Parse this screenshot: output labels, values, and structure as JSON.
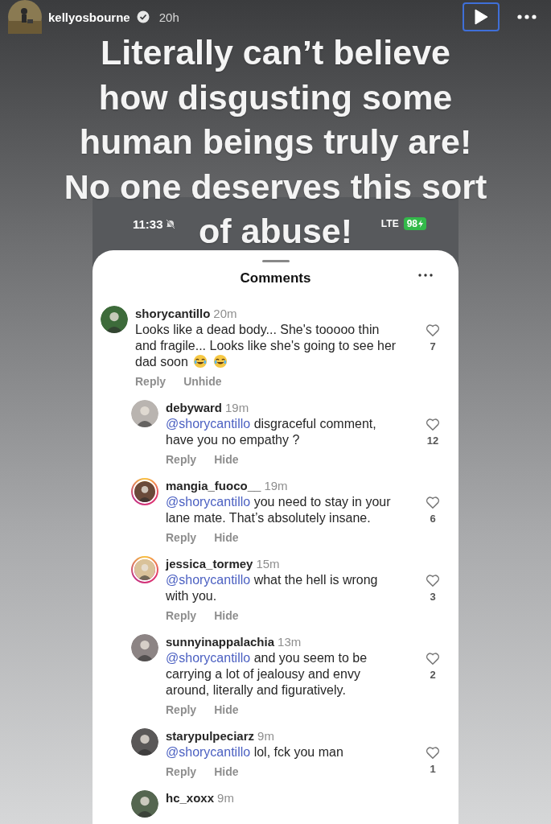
{
  "story": {
    "username": "kellyosbourne",
    "verified": true,
    "time": "20h"
  },
  "caption_lines": [
    "Literally can’t believe",
    "how disgusting some",
    "human beings truly are!",
    "No one deserves this sort",
    "of abuse!"
  ],
  "screenshot": {
    "status_bar": {
      "time": "11:33",
      "muted": true,
      "network": "LTE",
      "battery": "98"
    },
    "sheet_title": "Comments",
    "comments": [
      {
        "user": "shorycantillo",
        "time": "20m",
        "text": "Looks like a dead body... She's tooooo thin and fragile... Looks like she's going to see her dad soon",
        "ends_with_emojis": true,
        "likes": "7",
        "story_ring": false,
        "actions": [
          "Reply",
          "Unhide"
        ],
        "children": [
          {
            "user": "debyward",
            "time": "19m",
            "mention": "@shorycantillo",
            "text": "disgraceful comment, have you no empathy ?",
            "likes": "12",
            "story_ring": false,
            "actions": [
              "Reply",
              "Hide"
            ]
          },
          {
            "user": "mangia_fuoco__",
            "time": "19m",
            "mention": "@shorycantillo",
            "text": "you need to stay in your lane mate. That’s absolutely insane.",
            "likes": "6",
            "story_ring": true,
            "actions": [
              "Reply",
              "Hide"
            ]
          },
          {
            "user": "jessica_tormey",
            "time": "15m",
            "mention": "@shorycantillo",
            "text": "what the hell is wrong with you.",
            "likes": "3",
            "story_ring": true,
            "actions": [
              "Reply",
              "Hide"
            ]
          },
          {
            "user": "sunnyinappalachia",
            "time": "13m",
            "mention": "@shorycantillo",
            "text": "and you seem to be carrying a lot of jealousy and envy around, literally and figuratively.",
            "likes": "2",
            "story_ring": false,
            "actions": [
              "Reply",
              "Hide"
            ]
          },
          {
            "user": "starypulpeciarz",
            "time": "9m",
            "mention": "@shorycantillo",
            "text": "lol, fck you man",
            "likes": "1",
            "story_ring": false,
            "actions": [
              "Reply",
              "Hide"
            ]
          },
          {
            "user": "hc_xoxx",
            "time": "9m",
            "story_ring": false
          }
        ]
      }
    ]
  }
}
